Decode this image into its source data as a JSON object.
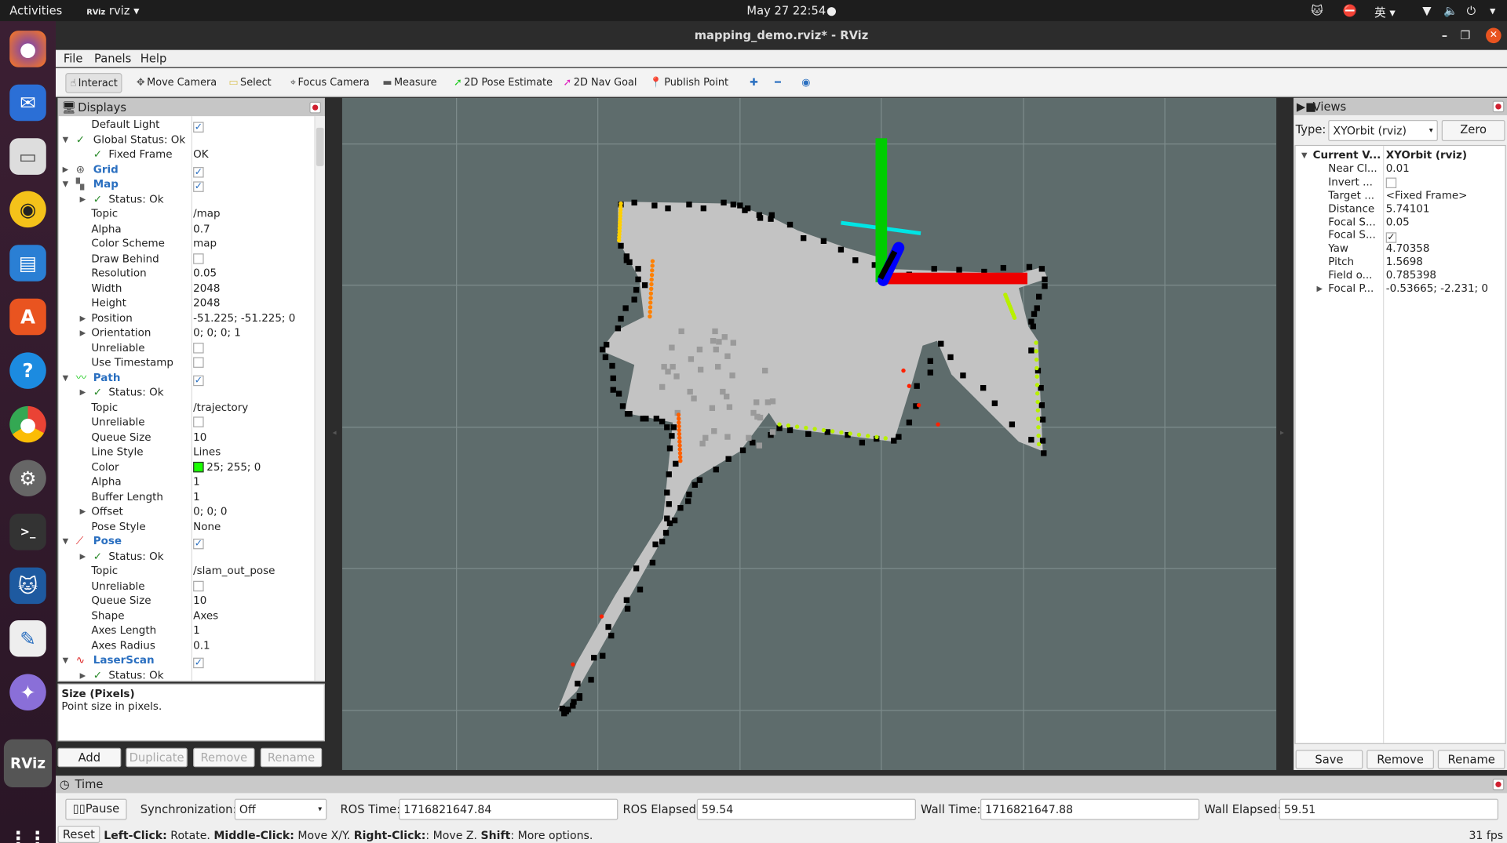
{
  "topbar": {
    "activities": "Activities",
    "app": "rviz",
    "datetime": "May 27  22:54",
    "ime": "英"
  },
  "window": {
    "title": "mapping_demo.rviz* - RViz"
  },
  "menu": [
    "File",
    "Panels",
    "Help"
  ],
  "toolbar": [
    {
      "label": "Interact",
      "icon": "hand-icon",
      "active": true
    },
    {
      "label": "Move Camera",
      "icon": "move-camera-icon"
    },
    {
      "label": "Select",
      "icon": "select-icon"
    },
    {
      "label": "Focus Camera",
      "icon": "focus-camera-icon"
    },
    {
      "label": "Measure",
      "icon": "ruler-icon"
    },
    {
      "label": "2D Pose Estimate",
      "icon": "pose-estimate-arrow-icon"
    },
    {
      "label": "2D Nav Goal",
      "icon": "nav-goal-arrow-icon"
    },
    {
      "label": "Publish Point",
      "icon": "map-pin-icon"
    }
  ],
  "displays": {
    "title": "Displays",
    "rows": [
      {
        "l": "Default Light",
        "v": "check",
        "lvl": 2
      },
      {
        "l": "Global Status: Ok",
        "lvl": 1,
        "arrow": "open",
        "icon": "ok"
      },
      {
        "l": "Fixed Frame",
        "v": "OK",
        "lvl": 2,
        "icon": "ok"
      },
      {
        "l": "Grid",
        "v": "check",
        "lvl": 1,
        "arrow": "closed",
        "icon": "grid",
        "blue": true
      },
      {
        "l": "Map",
        "v": "check",
        "lvl": 1,
        "arrow": "open",
        "icon": "map",
        "blue": true
      },
      {
        "l": "Status: Ok",
        "lvl": 2,
        "arrow": "closed",
        "icon": "ok"
      },
      {
        "l": "Topic",
        "v": "/map",
        "lvl": 2
      },
      {
        "l": "Alpha",
        "v": "0.7",
        "lvl": 2
      },
      {
        "l": "Color Scheme",
        "v": "map",
        "lvl": 2
      },
      {
        "l": "Draw Behind",
        "v": "uncheck",
        "lvl": 2
      },
      {
        "l": "Resolution",
        "v": "0.05",
        "lvl": 2
      },
      {
        "l": "Width",
        "v": "2048",
        "lvl": 2
      },
      {
        "l": "Height",
        "v": "2048",
        "lvl": 2
      },
      {
        "l": "Position",
        "v": "-51.225; -51.225; 0",
        "lvl": 2,
        "arrow": "closed"
      },
      {
        "l": "Orientation",
        "v": "0; 0; 0; 1",
        "lvl": 2,
        "arrow": "closed"
      },
      {
        "l": "Unreliable",
        "v": "uncheck",
        "lvl": 2
      },
      {
        "l": "Use Timestamp",
        "v": "uncheck",
        "lvl": 2
      },
      {
        "l": "Path",
        "v": "check",
        "lvl": 1,
        "arrow": "open",
        "icon": "path",
        "blue": true
      },
      {
        "l": "Status: Ok",
        "lvl": 2,
        "arrow": "closed",
        "icon": "ok"
      },
      {
        "l": "Topic",
        "v": "/trajectory",
        "lvl": 2
      },
      {
        "l": "Unreliable",
        "v": "uncheck",
        "lvl": 2
      },
      {
        "l": "Queue Size",
        "v": "10",
        "lvl": 2
      },
      {
        "l": "Line Style",
        "v": "Lines",
        "lvl": 2
      },
      {
        "l": "Color",
        "v": "25; 255; 0",
        "swatch": "#19ff00",
        "lvl": 2
      },
      {
        "l": "Alpha",
        "v": "1",
        "lvl": 2
      },
      {
        "l": "Buffer Length",
        "v": "1",
        "lvl": 2
      },
      {
        "l": "Offset",
        "v": "0; 0; 0",
        "lvl": 2,
        "arrow": "closed"
      },
      {
        "l": "Pose Style",
        "v": "None",
        "lvl": 2
      },
      {
        "l": "Pose",
        "v": "check",
        "lvl": 1,
        "arrow": "open",
        "icon": "pose",
        "blue": true
      },
      {
        "l": "Status: Ok",
        "lvl": 2,
        "arrow": "closed",
        "icon": "ok"
      },
      {
        "l": "Topic",
        "v": "/slam_out_pose",
        "lvl": 2
      },
      {
        "l": "Unreliable",
        "v": "uncheck",
        "lvl": 2
      },
      {
        "l": "Queue Size",
        "v": "10",
        "lvl": 2
      },
      {
        "l": "Shape",
        "v": "Axes",
        "lvl": 2
      },
      {
        "l": "Axes Length",
        "v": "1",
        "lvl": 2
      },
      {
        "l": "Axes Radius",
        "v": "0.1",
        "lvl": 2
      },
      {
        "l": "LaserScan",
        "v": "check",
        "lvl": 1,
        "arrow": "open",
        "icon": "laser",
        "blue": true
      },
      {
        "l": "Status: Ok",
        "lvl": 2,
        "arrow": "closed",
        "icon": "ok"
      }
    ],
    "desc_title": "Size (Pixels)",
    "desc_text": "Point size in pixels.",
    "buttons": {
      "add": "Add",
      "duplicate": "Duplicate",
      "remove": "Remove",
      "rename": "Rename"
    }
  },
  "views": {
    "title": "Views",
    "type_label": "Type:",
    "type_value": "XYOrbit (rviz)",
    "zero": "Zero",
    "rows": [
      {
        "l": "Current V...",
        "v": "XYOrbit (rviz)",
        "bold": true,
        "arrow": "open"
      },
      {
        "l": "Near Cl...",
        "v": "0.01"
      },
      {
        "l": "Invert ...",
        "v": "uncheck"
      },
      {
        "l": "Target ...",
        "v": "<Fixed Frame>"
      },
      {
        "l": "Distance",
        "v": "5.74101"
      },
      {
        "l": "Focal S...",
        "v": "0.05"
      },
      {
        "l": "Focal S...",
        "v": "check"
      },
      {
        "l": "Yaw",
        "v": "4.70358"
      },
      {
        "l": "Pitch",
        "v": "1.5698"
      },
      {
        "l": "Field o...",
        "v": "0.785398"
      },
      {
        "l": "Focal P...",
        "v": "-0.53665; -2.231; 0",
        "arrow": "closed"
      }
    ],
    "buttons": {
      "save": "Save",
      "remove": "Remove",
      "rename": "Rename"
    }
  },
  "time": {
    "title": "Time",
    "pause": "Pause",
    "sync_label": "Synchronization:",
    "sync_value": "Off",
    "ros_time_label": "ROS Time:",
    "ros_time": "1716821647.84",
    "ros_elapsed_label": "ROS Elapsed:",
    "ros_elapsed": "59.54",
    "wall_time_label": "Wall Time:",
    "wall_time": "1716821647.88",
    "wall_elapsed_label": "Wall Elapsed:",
    "wall_elapsed": "59.51"
  },
  "status": {
    "reset": "Reset",
    "k1": "Left-Click:",
    "t1": " Rotate. ",
    "k2": "Middle-Click:",
    "t2": " Move X/Y. ",
    "k3": "Right-Click:",
    "t3": ": Move Z. ",
    "k4": "Shift",
    "t4": ": More options.",
    "fps": "31 fps"
  },
  "colors": {
    "viewport_bg": "#5e6c6c",
    "map_free": "#c3c3c3",
    "axis_x": "#ff0000",
    "axis_y": "#00cc00",
    "axis_z": "#0000ff",
    "trajectory": "#19ff00"
  }
}
